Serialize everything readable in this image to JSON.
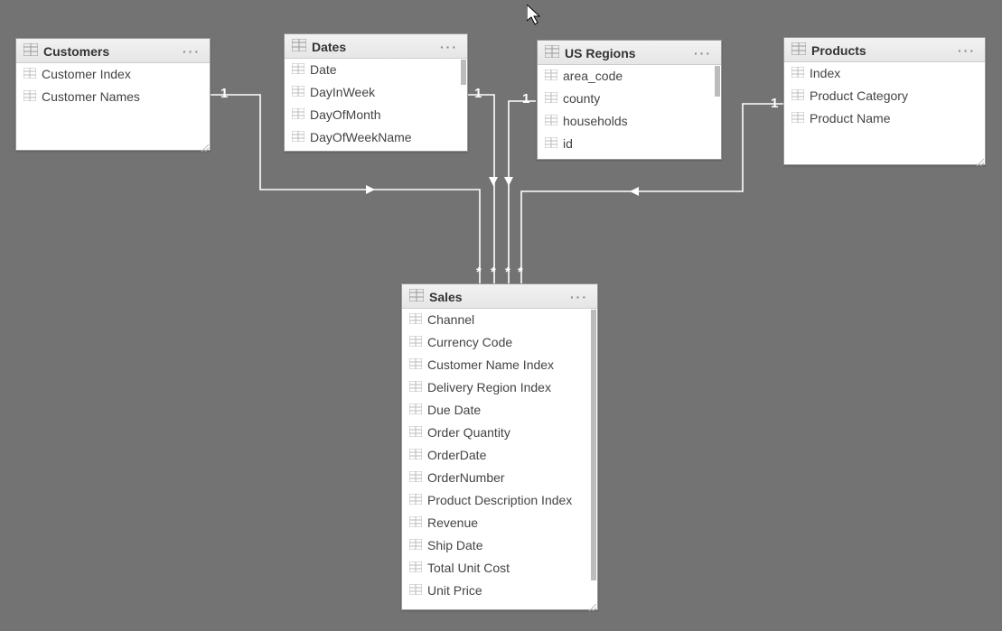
{
  "tables": {
    "customers": {
      "title": "Customers",
      "fields": [
        "Customer Index",
        "Customer Names"
      ]
    },
    "dates": {
      "title": "Dates",
      "fields": [
        "Date",
        "DayInWeek",
        "DayOfMonth",
        "DayOfWeekName"
      ]
    },
    "us_regions": {
      "title": "US Regions",
      "fields": [
        "area_code",
        "county",
        "households",
        "id"
      ]
    },
    "products": {
      "title": "Products",
      "fields": [
        "Index",
        "Product Category",
        "Product Name"
      ]
    },
    "sales": {
      "title": "Sales",
      "fields": [
        "Channel",
        "Currency Code",
        "Customer Name Index",
        "Delivery Region Index",
        "Due Date",
        "Order Quantity",
        "OrderDate",
        "OrderNumber",
        "Product Description Index",
        "Revenue",
        "Ship Date",
        "Total Unit Cost",
        "Unit Price"
      ]
    }
  },
  "cardinality_label": "1",
  "many_glyph": "*",
  "more_glyph": "···"
}
